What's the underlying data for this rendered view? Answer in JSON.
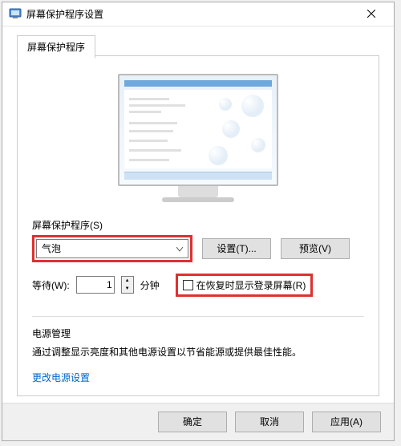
{
  "titlebar": {
    "title": "屏幕保护程序设置"
  },
  "tab": {
    "label": "屏幕保护程序"
  },
  "screensaver": {
    "section_label": "屏幕保护程序(S)",
    "selected": "气泡",
    "settings_btn": "设置(T)...",
    "preview_btn": "预览(V)"
  },
  "wait": {
    "label": "等待(W):",
    "value": "1",
    "unit": "分钟",
    "resume_checkbox_label": "在恢复时显示登录屏幕(R)",
    "resume_checked": false
  },
  "power": {
    "title": "电源管理",
    "desc": "通过调整显示亮度和其他电源设置以节省能源或提供最佳性能。",
    "link": "更改电源设置"
  },
  "buttons": {
    "ok": "确定",
    "cancel": "取消",
    "apply": "应用(A)"
  }
}
